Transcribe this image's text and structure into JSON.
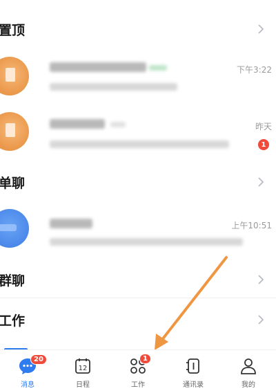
{
  "sections": {
    "pinned": "置顶",
    "single": "单聊",
    "group": "群聊",
    "work": "工作"
  },
  "chats": [
    {
      "time": "下午3:22",
      "unread": ""
    },
    {
      "time": "昨天",
      "unread": "1"
    },
    {
      "time": "上午10:51",
      "unread": ""
    }
  ],
  "tabs": [
    {
      "label": "消息",
      "icon": "chat-bubble-icon",
      "badge": "20"
    },
    {
      "label": "日程",
      "icon": "calendar-icon",
      "badge": ""
    },
    {
      "label": "工作",
      "icon": "apps-grid-icon",
      "badge": "1"
    },
    {
      "label": "通讯录",
      "icon": "contacts-book-icon",
      "badge": ""
    },
    {
      "label": "我的",
      "icon": "person-icon",
      "badge": ""
    }
  ],
  "calendar_day": "12",
  "colors": {
    "accent": "#2f7bf0",
    "badge": "#f04a3a",
    "annotation_arrow": "#ef9642"
  }
}
